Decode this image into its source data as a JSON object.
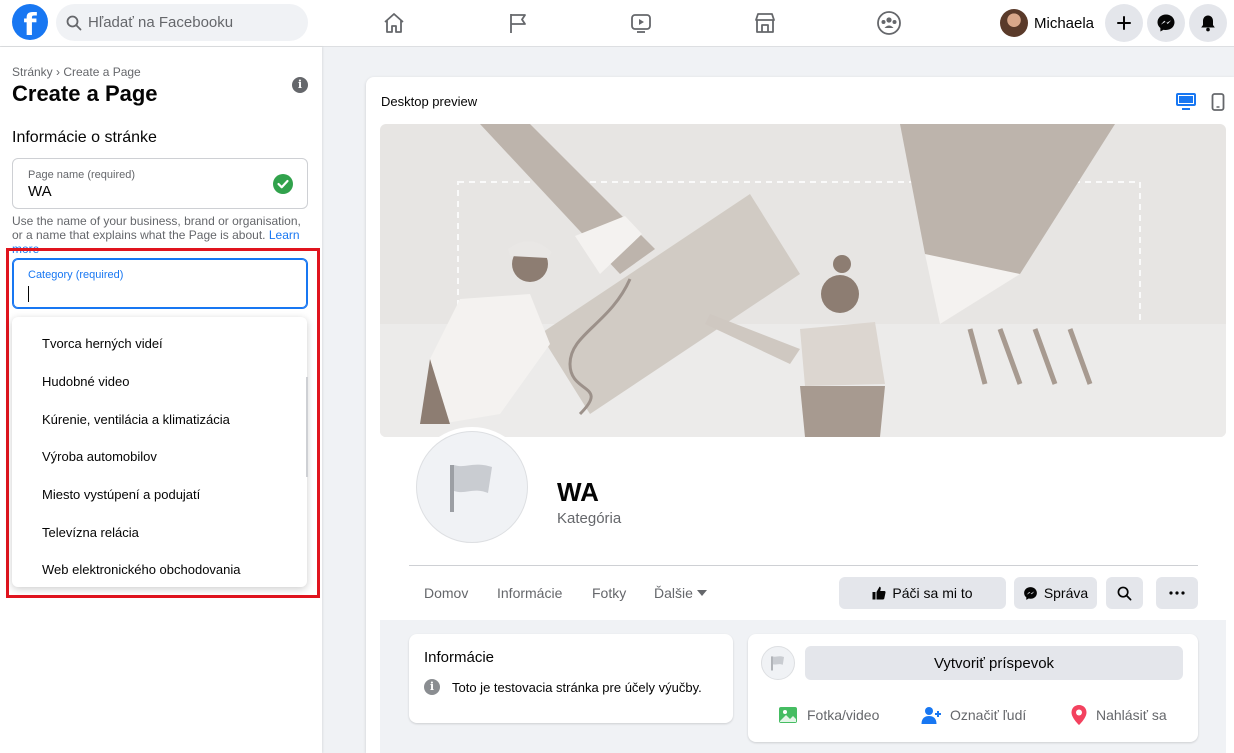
{
  "topbar": {
    "logo": "f",
    "search_placeholder": "Hľadať na Facebooku",
    "nav_icons": [
      "home-icon",
      "flag-icon",
      "video-icon",
      "marketplace-icon",
      "groups-icon"
    ],
    "profile_name": "Michaela",
    "action_icons": [
      "plus-icon",
      "messenger-icon",
      "bell-icon"
    ]
  },
  "left_panel": {
    "breadcrumb": "Stránky › Create a Page",
    "title": "Create a Page",
    "section_title": "Informácie o stránke",
    "page_name_field": {
      "label": "Page name (required)",
      "value": "WA"
    },
    "helper_text": "Use the name of your business, brand or organisation, or a name that explains what the Page is about.",
    "learn_more": "Learn more",
    "category_field": {
      "label": "Category (required)",
      "value": ""
    },
    "category_options": [
      "Tvorca herných videí",
      "Hudobné video",
      "Kúrenie, ventilácia a klimatizácia",
      "Výroba automobilov",
      "Miesto vystúpení a podujatí",
      "Televízna relácia",
      "Web elektronického obchodovania"
    ]
  },
  "preview": {
    "title": "Desktop preview",
    "page_name": "WA",
    "page_category": "Kategória",
    "tabs": [
      "Domov",
      "Informácie",
      "Fotky",
      "Ďalšie"
    ],
    "like_button": "Páči sa mi to",
    "message_button": "Správa",
    "info_card": {
      "title": "Informácie",
      "description": "Toto je testovacia stránka pre účely výučby."
    },
    "create_post": "Vytvoriť príspevok",
    "post_actions": [
      "Fotka/video",
      "Označiť ľudí",
      "Nahlásiť sa"
    ]
  },
  "colors": {
    "brand": "#1877f2",
    "highlight_border": "#e0141e",
    "success": "#31a24c",
    "background": "#f0f2f5"
  }
}
